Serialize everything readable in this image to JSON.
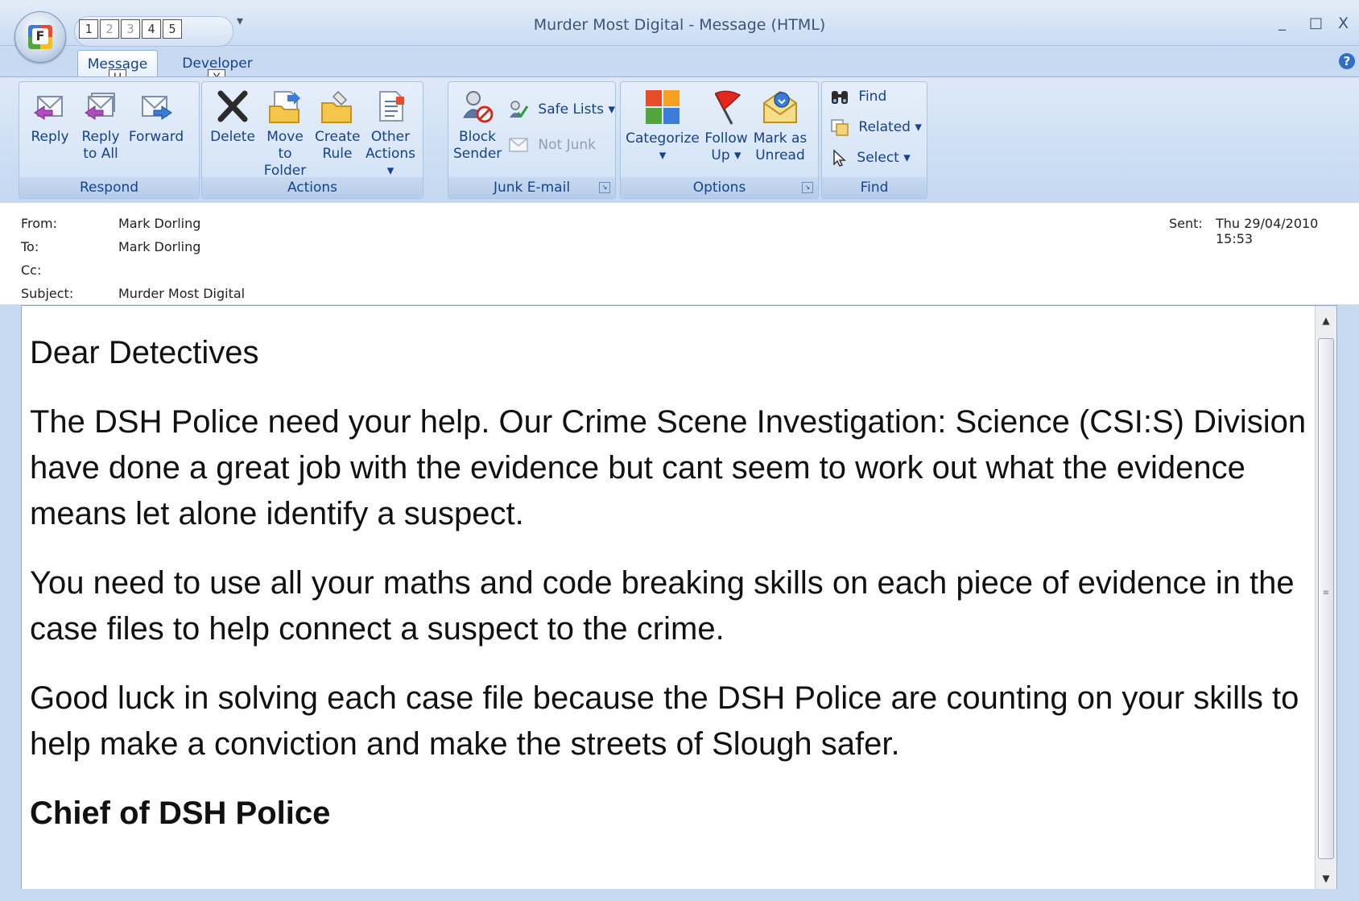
{
  "window": {
    "title": "Murder Most Digital - Message (HTML)",
    "controls": {
      "minimize": "_",
      "maximize": "□",
      "close": "X"
    },
    "help": "?"
  },
  "office_button": {
    "keytip": "F"
  },
  "quick_access": {
    "keytips": [
      "1",
      "2",
      "3",
      "4",
      "5"
    ],
    "customize": "▾"
  },
  "tabs": [
    {
      "label": "Message",
      "keytip": "H",
      "active": true
    },
    {
      "label": "Developer",
      "keytip": "Y",
      "active": false
    }
  ],
  "ribbon": {
    "respond": {
      "label": "Respond",
      "reply": "Reply",
      "reply_all_1": "Reply",
      "reply_all_2": "to All",
      "forward": "Forward"
    },
    "actions": {
      "label": "Actions",
      "delete": "Delete",
      "move_1": "Move to",
      "move_2": "Folder ▾",
      "rule_1": "Create",
      "rule_2": "Rule",
      "other_1": "Other",
      "other_2": "Actions ▾"
    },
    "junk": {
      "label": "Junk E-mail",
      "block_1": "Block",
      "block_2": "Sender",
      "safe_lists": "Safe Lists ▾",
      "not_junk": "Not Junk"
    },
    "options": {
      "label": "Options",
      "categorize_1": "Categorize",
      "categorize_2": "▾",
      "follow_1": "Follow",
      "follow_2": "Up ▾",
      "mark_1": "Mark as",
      "mark_2": "Unread"
    },
    "find": {
      "label": "Find",
      "find": "Find",
      "related": "Related ▾",
      "select": "Select ▾"
    }
  },
  "header": {
    "from_label": "From:",
    "from": "Mark Dorling",
    "to_label": "To:",
    "to": "Mark Dorling",
    "cc_label": "Cc:",
    "cc": "",
    "subject_label": "Subject:",
    "subject": "Murder Most Digital",
    "sent_label": "Sent:",
    "sent": "Thu 29/04/2010 15:53"
  },
  "body": {
    "greeting": "Dear Detectives",
    "p1": "The DSH Police need your help. Our Crime Scene Investigation: Science (CSI:S) Division have done a great job with the evidence but cant seem to work out what the evidence means let alone identify a suspect.",
    "p2": "You need to use all your maths and code breaking skills on each piece of evidence in the case files to help connect a suspect to the crime.",
    "p3": "Good luck in solving each case file because the DSH Police are counting on your skills to help make a conviction and make the streets of Slough safer.",
    "signature": "Chief of DSH Police"
  },
  "scrollbar": {
    "up": "▲",
    "down": "▼",
    "grip": "≡"
  }
}
